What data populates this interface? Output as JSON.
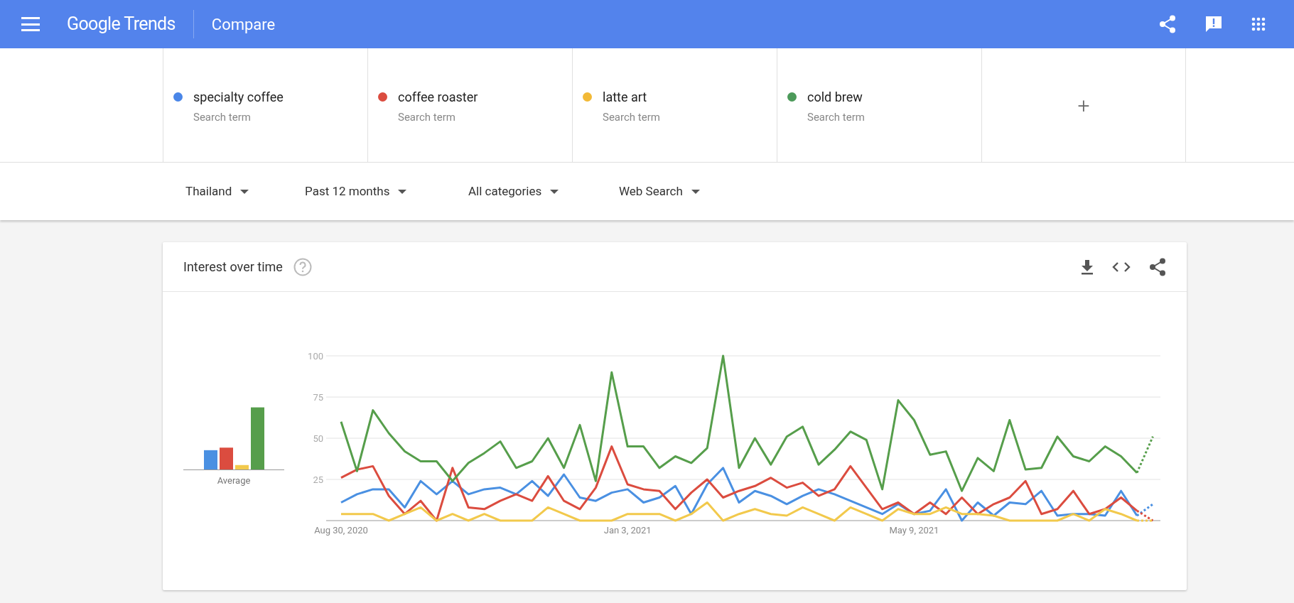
{
  "app_bar": {
    "title": "Google Trends",
    "page": "Compare"
  },
  "search_terms": [
    {
      "term": "specialty coffee",
      "subtitle": "Search term",
      "color": "#4a86e8"
    },
    {
      "term": "coffee roaster",
      "subtitle": "Search term",
      "color": "#db4c3f"
    },
    {
      "term": "latte art",
      "subtitle": "Search term",
      "color": "#f2b936"
    },
    {
      "term": "cold brew",
      "subtitle": "Search term",
      "color": "#4c9a5a"
    }
  ],
  "add_term": {
    "label": "+"
  },
  "filters": [
    {
      "label": "Thailand"
    },
    {
      "label": "Past 12 months"
    },
    {
      "label": "All categories"
    },
    {
      "label": "Web Search"
    }
  ],
  "interest_over_time": {
    "title": "Interest over time",
    "average_label": "Average",
    "incomplete_last_point": true,
    "chart_data": {
      "type": "line",
      "categories": [
        "Aug 30, 2020",
        null,
        null,
        null,
        null,
        null,
        null,
        null,
        null,
        null,
        null,
        null,
        null,
        null,
        null,
        null,
        null,
        null,
        "Jan 3, 2021",
        null,
        null,
        null,
        null,
        null,
        null,
        null,
        null,
        null,
        null,
        null,
        null,
        null,
        null,
        null,
        null,
        null,
        "May 9, 2021",
        null,
        null,
        null,
        null,
        null,
        null,
        null,
        null,
        null,
        null,
        null,
        null,
        null,
        null,
        null
      ],
      "ylim": [
        0,
        100
      ],
      "grid": true,
      "yticks": [
        25,
        50,
        75,
        100
      ],
      "series": [
        {
          "color": "#4a90e2",
          "values": [
            11,
            16,
            19,
            19,
            8,
            24,
            16,
            24,
            16,
            19,
            20,
            16,
            24,
            15,
            28,
            14,
            12,
            17,
            19,
            11,
            14,
            21,
            4,
            22,
            32,
            11,
            18,
            15,
            10,
            15,
            19,
            16,
            12,
            8,
            4,
            10,
            4,
            6,
            19,
            0,
            11,
            3,
            11,
            10,
            18,
            3,
            4,
            4,
            3,
            18,
            3,
            10
          ]
        },
        {
          "color": "#db4c3f",
          "values": [
            26,
            31,
            33,
            15,
            4,
            12,
            0,
            32,
            8,
            7,
            12,
            16,
            12,
            27,
            12,
            7,
            20,
            45,
            22,
            19,
            18,
            7,
            17,
            25,
            14,
            18,
            21,
            26,
            20,
            23,
            15,
            19,
            33,
            20,
            7,
            11,
            4,
            11,
            4,
            14,
            4,
            10,
            14,
            24,
            4,
            7,
            18,
            4,
            7,
            14,
            6,
            0
          ]
        },
        {
          "color": "#f2c94c",
          "values": [
            4,
            4,
            4,
            0,
            4,
            8,
            0,
            4,
            0,
            4,
            0,
            0,
            0,
            8,
            4,
            0,
            0,
            0,
            4,
            4,
            4,
            0,
            4,
            11,
            0,
            4,
            7,
            4,
            3,
            8,
            4,
            0,
            8,
            4,
            0,
            7,
            4,
            4,
            8,
            4,
            4,
            3,
            0,
            0,
            0,
            0,
            4,
            0,
            7,
            4,
            0,
            0
          ]
        },
        {
          "color": "#569e4b",
          "values": [
            60,
            30,
            67,
            53,
            42,
            36,
            36,
            24,
            35,
            41,
            48,
            32,
            36,
            50,
            32,
            58,
            24,
            90,
            45,
            45,
            32,
            39,
            35,
            44,
            100,
            32,
            50,
            34,
            51,
            57,
            34,
            43,
            54,
            49,
            19,
            73,
            61,
            40,
            42,
            18,
            38,
            30,
            61,
            31,
            32,
            51,
            39,
            36,
            45,
            39,
            29,
            51
          ]
        }
      ]
    }
  }
}
